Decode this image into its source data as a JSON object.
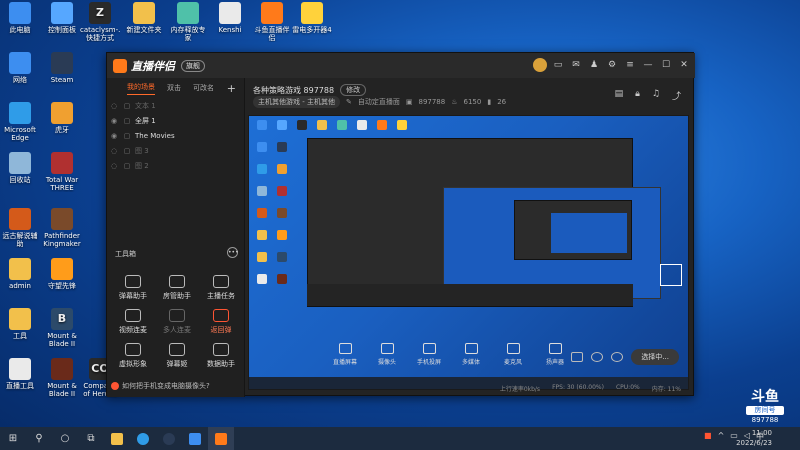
{
  "desktop_icons": [
    {
      "label": "此电脑",
      "color": "#3d8ef0"
    },
    {
      "label": "控制面板",
      "color": "#56a7ff"
    },
    {
      "label": "cataclysm-...\n快捷方式",
      "color": "#2a2a2a",
      "glyph": "Z"
    },
    {
      "label": "新建文件夹",
      "color": "#f2c04b"
    },
    {
      "label": "内存释放专家",
      "color": "#4fc1a9"
    },
    {
      "label": "Kenshi",
      "color": "#eaeaea"
    },
    {
      "label": "斗鱼直播伴侣",
      "color": "#ff7a1a"
    },
    {
      "label": "雷电多开器4",
      "color": "#ffd23b"
    },
    {
      "label": "网络",
      "color": "#3d8ef0"
    },
    {
      "label": "Steam",
      "color": "#2a3b55"
    },
    {
      "label": "Microsoft Edge",
      "color": "#2f9ce8"
    },
    {
      "label": "虎牙",
      "color": "#f0a030"
    },
    {
      "label": "回收站",
      "color": "#8fb7d9"
    },
    {
      "label": "Total War THREE KIN...",
      "color": "#b03030"
    },
    {
      "label": "远古解说辅助",
      "color": "#d45a1a"
    },
    {
      "label": "Pathfinder Kingmaker",
      "color": "#7a4a2a"
    },
    {
      "label": "admin",
      "color": "#f2c04b"
    },
    {
      "label": "守望先锋",
      "color": "#ff9c1a"
    },
    {
      "label": "工具",
      "color": "#f2c04b"
    },
    {
      "label": "Mount & Blade II",
      "color": "#2c4a6a",
      "glyph": "B"
    },
    {
      "label": "直播工具",
      "color": "#eaeaea"
    },
    {
      "label": "Mount & Blade II",
      "color": "#6a2a1a"
    },
    {
      "label": "Company of Heroes 2",
      "color": "#2a2a2a",
      "glyph": "CO"
    }
  ],
  "app": {
    "logo_text": "直播伴侣",
    "badge": "旗舰",
    "tabs": [
      "我的场景",
      "双击",
      "可改名"
    ],
    "plus": "+",
    "scenes": [
      {
        "name": "文本 1",
        "on": false
      },
      {
        "name": "全屏 1",
        "on": true
      },
      {
        "name": "The Movies",
        "on": true
      },
      {
        "name": "图 3",
        "on": false
      },
      {
        "name": "图 2",
        "on": false
      }
    ],
    "tools_title": "工具箱",
    "tools": [
      {
        "label": "弹幕助手",
        "state": "normal"
      },
      {
        "label": "房管助手",
        "state": "normal"
      },
      {
        "label": "主播任务",
        "state": "normal"
      },
      {
        "label": "视频连麦",
        "state": "normal"
      },
      {
        "label": "多人连麦",
        "state": "dim"
      },
      {
        "label": "返回弹",
        "state": "red"
      },
      {
        "label": "虚拟形象",
        "state": "normal"
      },
      {
        "label": "弹幕姬",
        "state": "normal"
      },
      {
        "label": "数据助手",
        "state": "normal"
      }
    ],
    "hint": "如何把手机变成电脑摄像头?",
    "room": {
      "title": "各种策略游戏 897788",
      "edit_label": "修改",
      "category": "主机其他游戏 - 主机其他",
      "auto_label": "自动定直播面",
      "room_id": "897788",
      "fans": "6150",
      "viewers": "26"
    },
    "bottom_tools": [
      "直播屏幕",
      "摄像头",
      "手机投屏",
      "多媒体",
      "麦克风",
      "扬声器"
    ],
    "go_live": "选择中...",
    "status": [
      "上行速率0kb/s",
      "FPS: 30 (60.00%)",
      "CPU:0%",
      "内存: 11%"
    ]
  },
  "taskbar": {
    "clock_time": "11:00",
    "clock_date": "2022/6/23"
  },
  "watermark": {
    "mark": "斗鱼",
    "sub": "房间号",
    "room": "897788"
  }
}
